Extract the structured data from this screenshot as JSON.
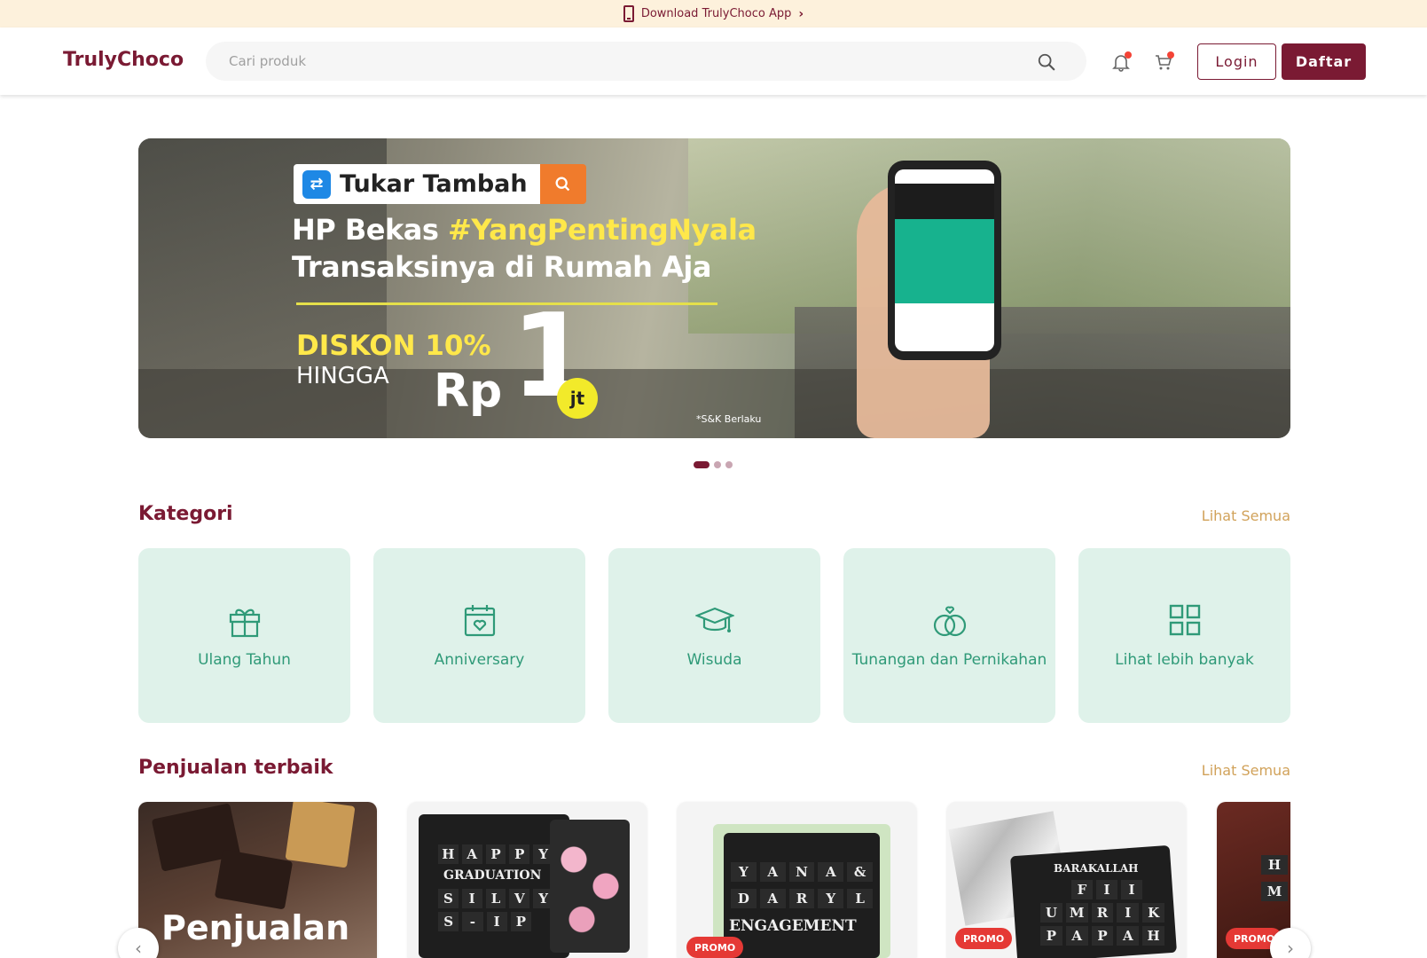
{
  "topbar": {
    "text": "Download TrulyChoco App",
    "icon": "phone-icon"
  },
  "header": {
    "logo": "TrulyChoco",
    "search_placeholder": "Cari produk",
    "login_label": "Login",
    "daftar_label": "Daftar"
  },
  "banner": {
    "brand": "Tukar Tambah",
    "headline_prefix": "HP Bekas ",
    "headline_hashtag": "#YangPentingNyala",
    "headline_line2": "Transaksinya di Rumah Aja",
    "discount": "DISKON 10%",
    "hingga": "HINGGA",
    "rp": "Rp",
    "amount": "1",
    "unit": "jt",
    "terms": "*S&K Berlaku",
    "slide_count": 3,
    "active_slide": 1
  },
  "kategori": {
    "title": "Kategori",
    "see_all": "Lihat Semua",
    "items": [
      {
        "label": "Ulang Tahun",
        "icon": "gift-icon"
      },
      {
        "label": "Anniversary",
        "icon": "calendar-heart-icon"
      },
      {
        "label": "Wisuda",
        "icon": "graduation-cap-icon"
      },
      {
        "label": "Tunangan dan Pernikahan",
        "icon": "rings-icon"
      },
      {
        "label": "Lihat lebih banyak",
        "icon": "grid-icon"
      }
    ]
  },
  "best": {
    "title": "Penjualan terbaik",
    "see_all": "Lihat Semua",
    "cover_text": "Penjualan",
    "products": [
      {
        "letters": [
          "H",
          "A",
          "P",
          "P",
          "Y"
        ],
        "line2": "GRADUATION",
        "line3": [
          "S",
          "I",
          "L",
          "V",
          "Y"
        ],
        "line4": [
          "S",
          "-",
          "I",
          "P"
        ]
      },
      {
        "promo": "PROMO",
        "letters": [
          "Y",
          "A",
          "N",
          "A",
          "&"
        ],
        "line2": [
          "D",
          "A",
          "R",
          "Y",
          "L"
        ],
        "line3": "ENGAGEMENT"
      },
      {
        "promo": "PROMO",
        "line1": "BARAKALLAH",
        "line2": [
          "F",
          "I",
          "I"
        ],
        "line3": [
          "U",
          "M",
          "R",
          "I",
          "K"
        ],
        "line4": [
          "P",
          "A",
          "P",
          "A",
          "H"
        ]
      },
      {
        "promo": "PROMO",
        "letters": [
          "H",
          "M"
        ]
      }
    ]
  },
  "colors": {
    "brand": "#7a1a33",
    "accent": "#d1a25a",
    "category_bg": "#dff2ea",
    "category_text": "#2f9a78",
    "promo": "#e53935"
  }
}
